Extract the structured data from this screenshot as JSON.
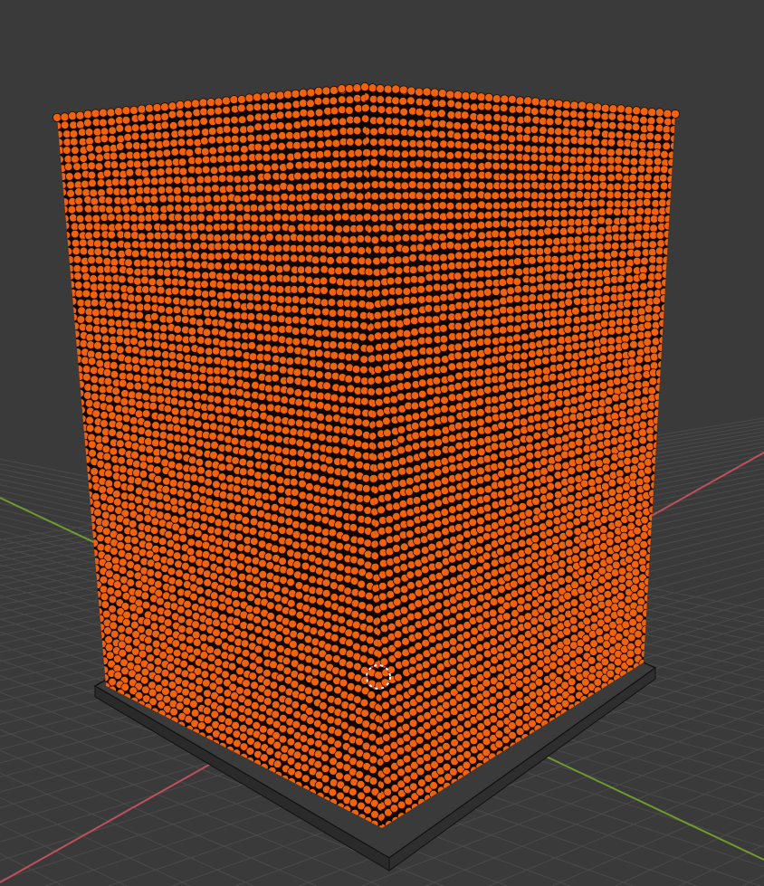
{
  "viewport": {
    "background_color": "#3a3a3a",
    "grid_color": "#4a4a4a",
    "x_axis_color": "#c0505e",
    "y_axis_color": "#6e9a2e",
    "particle_color": "#f0620e",
    "particle_outline_color": "#1a0a02",
    "cursor_icon": "3d-cursor-icon",
    "cursor_color_primary": "#ffffff",
    "cursor_color_secondary": "#e04040"
  }
}
